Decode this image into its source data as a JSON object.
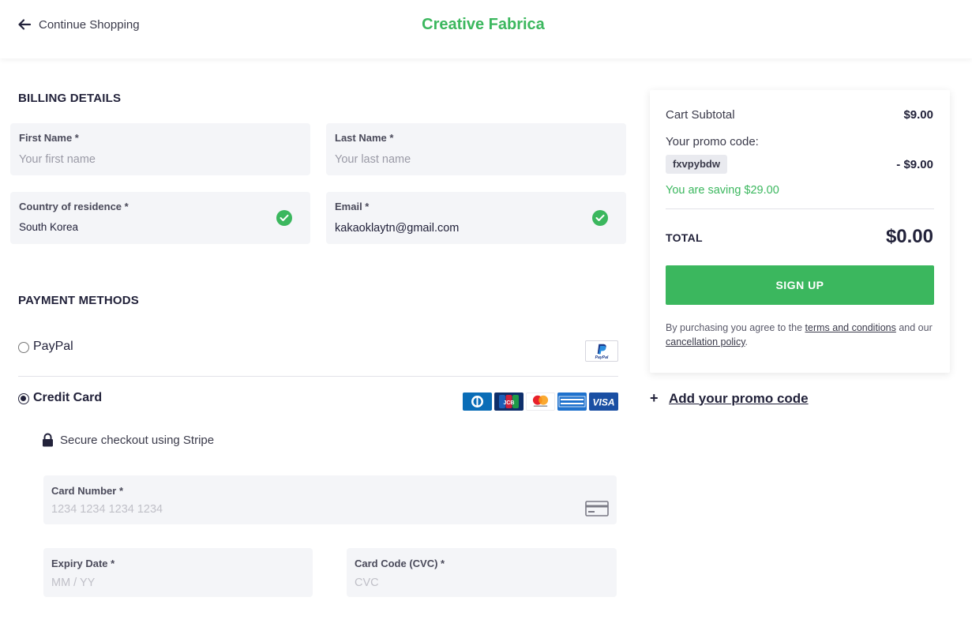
{
  "header": {
    "back_label": "Continue Shopping",
    "brand": "Creative Fabrica"
  },
  "billing": {
    "title": "BILLING DETAILS",
    "first_name": {
      "label": "First Name *",
      "placeholder": "Your first name",
      "value": ""
    },
    "last_name": {
      "label": "Last Name *",
      "placeholder": "Your last name",
      "value": ""
    },
    "country": {
      "label": "Country of residence *",
      "value": "South Korea"
    },
    "email": {
      "label": "Email *",
      "value": "kakaoklaytn@gmail.com"
    }
  },
  "payment": {
    "title": "PAYMENT METHODS",
    "methods": [
      {
        "label": "PayPal",
        "selected": false
      },
      {
        "label": "Credit Card",
        "selected": true
      }
    ],
    "paypal_logo_text": "PayPal",
    "card_brands": [
      "diners-icon",
      "jcb-icon",
      "mastercard-icon",
      "amex-icon",
      "visa-icon"
    ],
    "secure_text": "Secure checkout using Stripe",
    "card_number": {
      "label": "Card Number *",
      "placeholder": "1234 1234 1234 1234"
    },
    "expiry": {
      "label": "Expiry Date *",
      "placeholder": "MM / YY"
    },
    "cvc": {
      "label": "Card Code (CVC) *",
      "placeholder": "CVC"
    }
  },
  "summary": {
    "subtotal_label": "Cart Subtotal",
    "subtotal_value": "$9.00",
    "promo_label": "Your promo code:",
    "promo_code": "fxvpybdw",
    "promo_discount": "- $9.00",
    "saving_text": "You are saving $29.00",
    "total_label": "TOTAL",
    "total_value": "$0.00",
    "signup_label": "SIGN UP",
    "legal_prefix": "By purchasing you agree to the ",
    "terms_link": "terms and conditions",
    "legal_mid": " and our ",
    "cancellation_link": "cancellation policy",
    "legal_suffix": "."
  },
  "add_promo": {
    "plus": "+",
    "label": "Add your promo code"
  },
  "colors": {
    "accent": "#3bb75e",
    "text": "#22223a",
    "field_bg": "#f4f5f8"
  }
}
